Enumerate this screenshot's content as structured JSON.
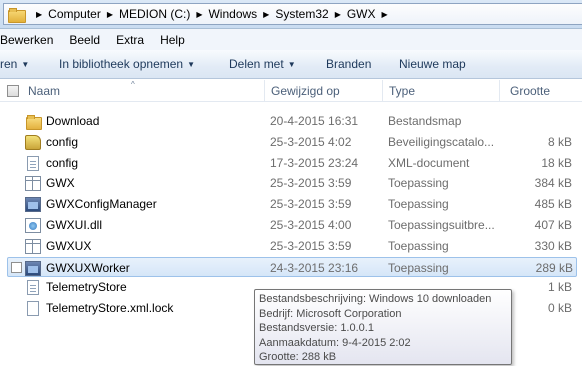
{
  "address": {
    "crumbs": [
      "Computer",
      "MEDION (C:)",
      "Windows",
      "System32",
      "GWX"
    ]
  },
  "menu": [
    "Bewerken",
    "Beeld",
    "Extra",
    "Help"
  ],
  "commands": {
    "organize": "ren",
    "library": "In bibliotheek opnemen",
    "share": "Delen met",
    "burn": "Branden",
    "new_folder": "Nieuwe map"
  },
  "columns": {
    "name": "Naam",
    "date": "Gewijzigd op",
    "type": "Type",
    "size": "Grootte"
  },
  "files": [
    {
      "name": "Download",
      "date": "20-4-2015 16:31",
      "type": "Bestandsmap",
      "size": "",
      "icon": "folder-icon"
    },
    {
      "name": "config",
      "date": "25-3-2015 4:02",
      "type": "Beveiligingscatalo...",
      "size": "8 kB",
      "icon": "security-catalog-icon"
    },
    {
      "name": "config",
      "date": "17-3-2015 23:24",
      "type": "XML-document",
      "size": "18 kB",
      "icon": "xml-document-icon"
    },
    {
      "name": "GWX",
      "date": "25-3-2015 3:59",
      "type": "Toepassing",
      "size": "384 kB",
      "icon": "application-icon"
    },
    {
      "name": "GWXConfigManager",
      "date": "25-3-2015 3:59",
      "type": "Toepassing",
      "size": "485 kB",
      "icon": "application-window-icon"
    },
    {
      "name": "GWXUI.dll",
      "date": "25-3-2015 4:00",
      "type": "Toepassingsuitbre...",
      "size": "407 kB",
      "icon": "dll-icon"
    },
    {
      "name": "GWXUX",
      "date": "25-3-2015 3:59",
      "type": "Toepassing",
      "size": "330 kB",
      "icon": "application-icon"
    },
    {
      "name": "GWXUXWorker",
      "date": "24-3-2015 23:16",
      "type": "Toepassing",
      "size": "289 kB",
      "icon": "application-window-icon",
      "selected": true
    },
    {
      "name": "TelemetryStore",
      "date": "",
      "type": "",
      "size": "1 kB",
      "icon": "xml-document-icon"
    },
    {
      "name": "TelemetryStore.xml.lock",
      "date": "",
      "type": "",
      "size": "0 kB",
      "icon": "file-icon"
    }
  ],
  "tooltip": {
    "description": "Bestandsbeschrijving: Windows 10 downloaden",
    "company": "Bedrijf: Microsoft Corporation",
    "version": "Bestandsversie: 1.0.0.1",
    "created": "Aanmaakdatum: 9-4-2015 2:02",
    "size": "Grootte: 288 kB"
  }
}
